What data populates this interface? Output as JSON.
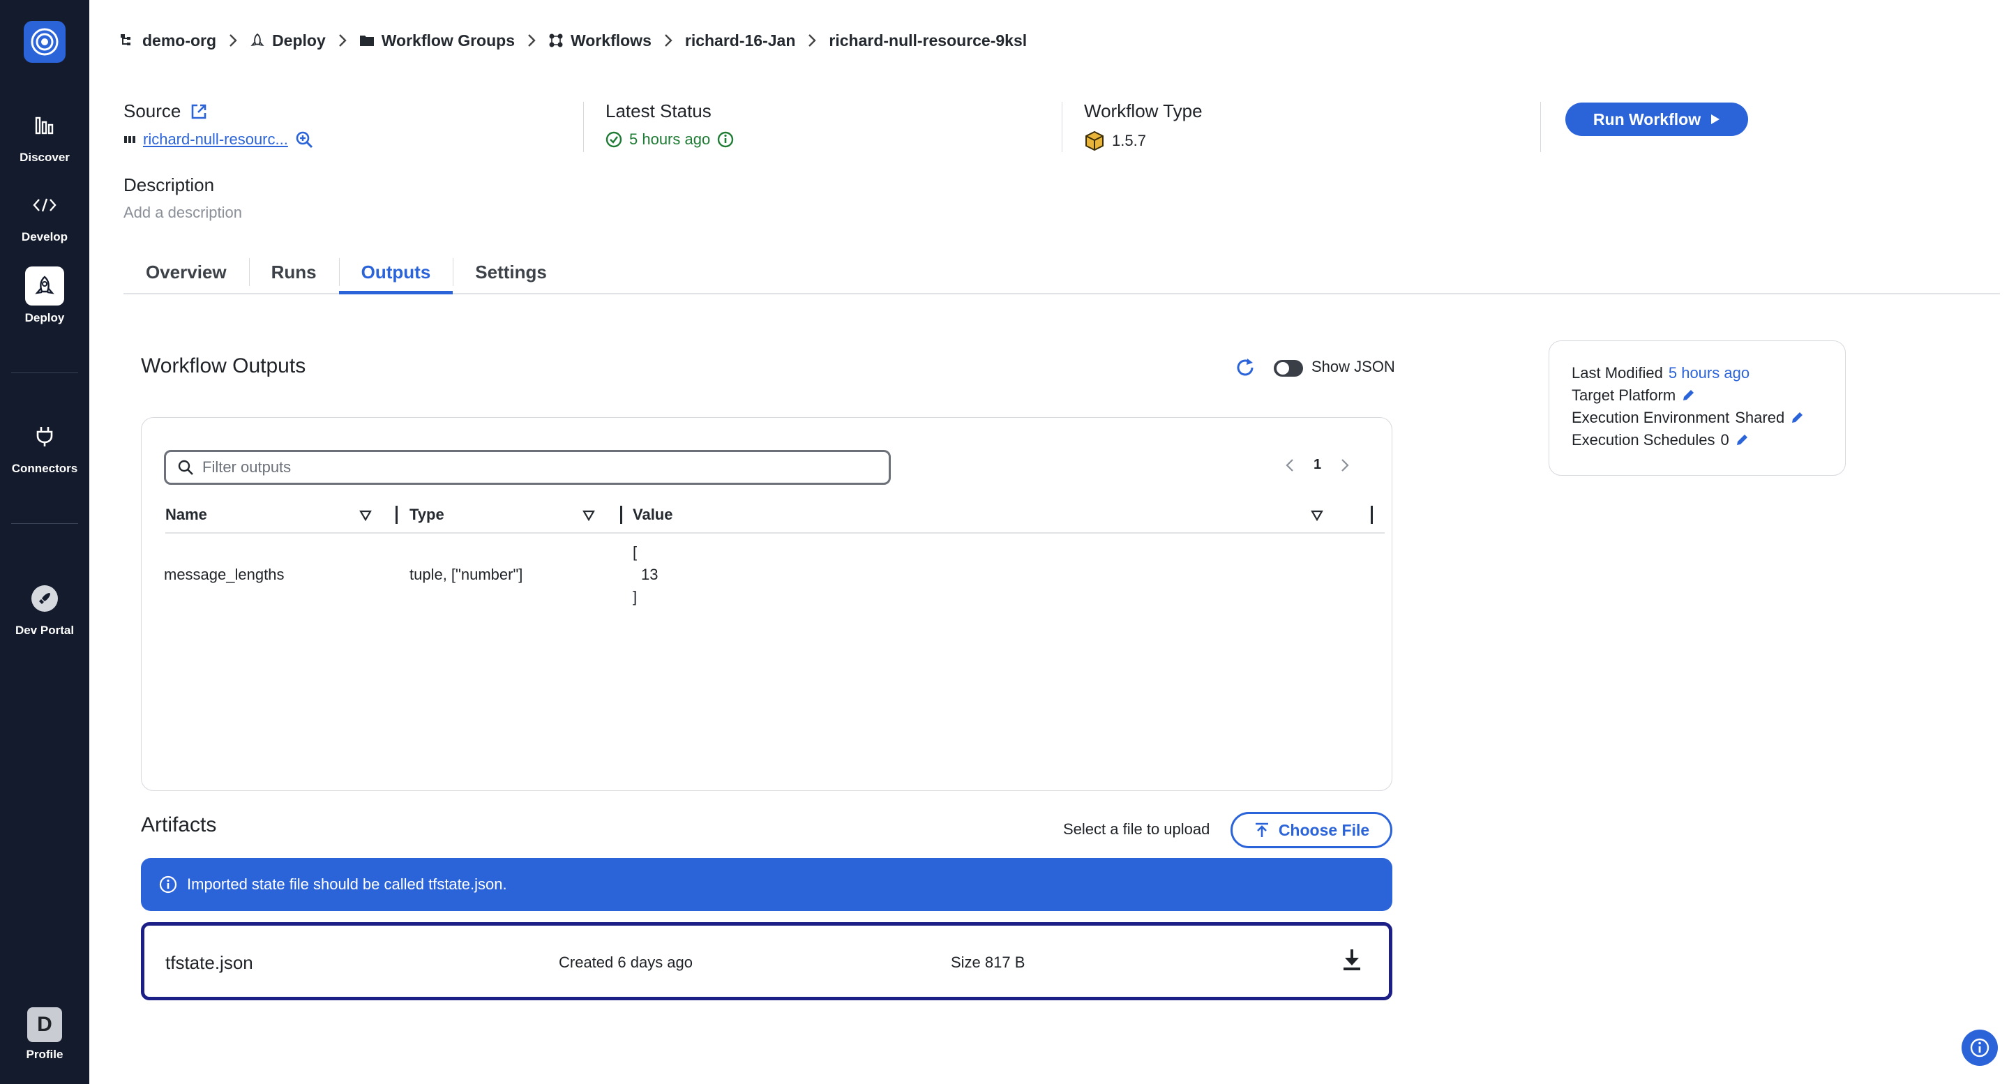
{
  "sidebar": {
    "items": [
      {
        "label": "Discover",
        "icon": "bar-chart-icon"
      },
      {
        "label": "Develop",
        "icon": "code-icon"
      },
      {
        "label": "Deploy",
        "icon": "deploy-icon"
      },
      {
        "label": "Connectors",
        "icon": "plug-icon"
      },
      {
        "label": "Dev Portal",
        "icon": "rocket-icon"
      }
    ],
    "profile": {
      "initial": "D",
      "label": "Profile"
    }
  },
  "breadcrumb": [
    "demo-org",
    "Deploy",
    "Workflow Groups",
    "Workflows",
    "richard-16-Jan",
    "richard-null-resource-9ksl"
  ],
  "header": {
    "source_title": "Source",
    "source_link": "richard-null-resourc...",
    "status_title": "Latest Status",
    "status_value": "5 hours ago",
    "type_title": "Workflow Type",
    "type_value": "1.5.7",
    "run_button": "Run Workflow",
    "description_title": "Description",
    "description_placeholder": "Add a description"
  },
  "tabs": [
    "Overview",
    "Runs",
    "Outputs",
    "Settings"
  ],
  "active_tab": "Outputs",
  "outputs": {
    "title": "Workflow Outputs",
    "show_json_label": "Show JSON",
    "show_json_on": false,
    "filter_placeholder": "Filter outputs",
    "page": "1",
    "columns": [
      "Name",
      "Type",
      "Value"
    ],
    "rows": [
      {
        "name": "message_lengths",
        "type": "tuple, [\"number\"]",
        "value_lines": [
          "[",
          "13",
          "]"
        ]
      }
    ]
  },
  "artifacts": {
    "title": "Artifacts",
    "upload_label": "Select a file to upload",
    "choose_button": "Choose File",
    "banner": "Imported state file should be called tfstate.json.",
    "file": {
      "name": "tfstate.json",
      "created": "Created 6 days ago",
      "size": "Size 817 B"
    }
  },
  "meta": {
    "last_modified_label": "Last Modified",
    "last_modified_value": "5 hours ago",
    "target_platform_label": "Target Platform",
    "exec_env_label": "Execution Environment",
    "exec_env_value": "Shared",
    "exec_sched_label": "Execution Schedules",
    "exec_sched_value": "0"
  },
  "colors": {
    "accent": "#2b63d9",
    "sidebar": "#141b2d",
    "success": "#1e7b34",
    "artifact_border": "#1b1f86"
  }
}
